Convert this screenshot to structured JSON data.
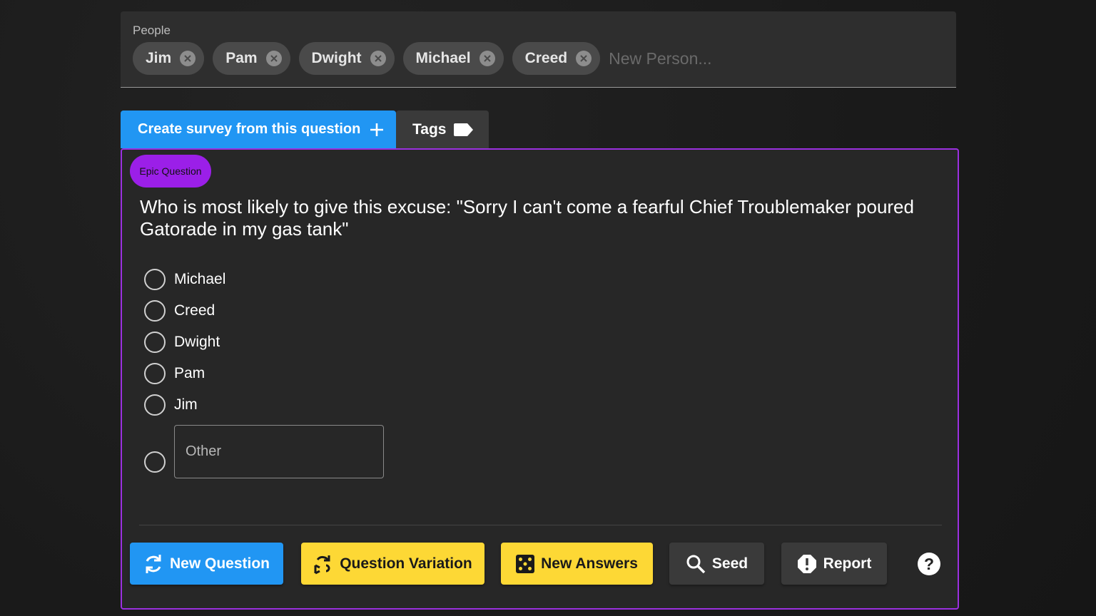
{
  "people": {
    "label": "People",
    "chips": [
      "Jim",
      "Pam",
      "Dwight",
      "Michael",
      "Creed"
    ],
    "new_person_placeholder": "New Person..."
  },
  "tabs": {
    "create_survey": "Create survey from this question",
    "tags": "Tags"
  },
  "card": {
    "badge": "Epic Question",
    "question": "Who is most likely to give this excuse: \"Sorry I can't come a fearful Chief Troublemaker poured Gatorade in my gas tank\"",
    "options": [
      "Michael",
      "Creed",
      "Dwight",
      "Pam",
      "Jim"
    ],
    "other_placeholder": "Other"
  },
  "actions": {
    "new_question": "New Question",
    "question_variation": "Question Variation",
    "new_answers": "New Answers",
    "seed": "Seed",
    "report": "Report",
    "help": "?"
  },
  "colors": {
    "accent_blue": "#2196f3",
    "accent_yellow": "#fdd835",
    "accent_purple": "#9b30e0"
  }
}
